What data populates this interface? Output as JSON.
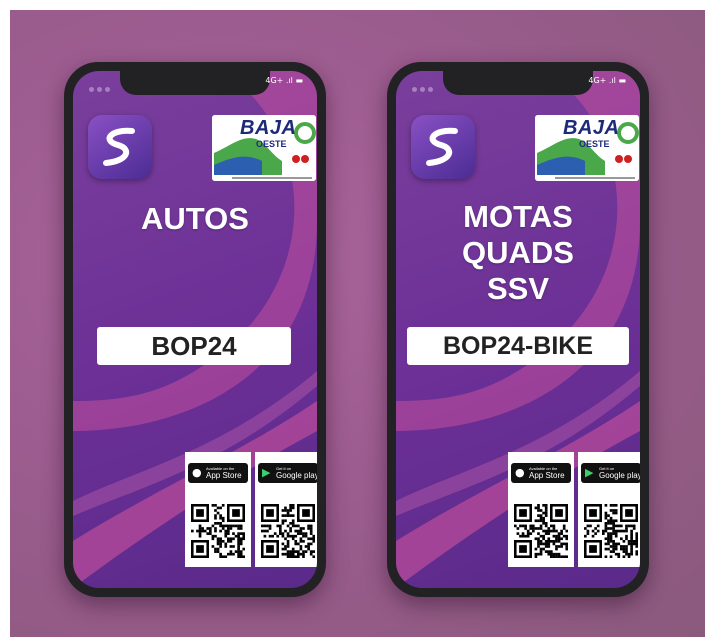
{
  "colors": {
    "background": "#9c5c8f",
    "screen_purple": "#6b2f96",
    "swoosh_pink": "#c4509c",
    "phone_frame": "#222224",
    "logo_blue": "#1d2a7a",
    "logo_green": "#4aa84a"
  },
  "phones": [
    {
      "status": "4G+ .ıl ▬",
      "app_icon": "app-icon-s-road",
      "event_logo": {
        "name": "BAJA",
        "subname": "OESTE"
      },
      "category_lines": [
        "AUTOS"
      ],
      "code": "BOP24",
      "stores": [
        {
          "icon": "apple-icon",
          "small": "Available on the",
          "big": "App Store"
        },
        {
          "icon": "google-play-icon",
          "small": "Get it on",
          "big": "Google play"
        }
      ]
    },
    {
      "status": "4G+ .ıl ▬",
      "app_icon": "app-icon-s-road",
      "event_logo": {
        "name": "BAJA",
        "subname": "OESTE"
      },
      "category_lines": [
        "MOTAS",
        "QUADS",
        "SSV"
      ],
      "code": "BOP24-BIKE",
      "stores": [
        {
          "icon": "apple-icon",
          "small": "Available on the",
          "big": "App Store"
        },
        {
          "icon": "google-play-icon",
          "small": "Get it on",
          "big": "Google play"
        }
      ]
    }
  ]
}
